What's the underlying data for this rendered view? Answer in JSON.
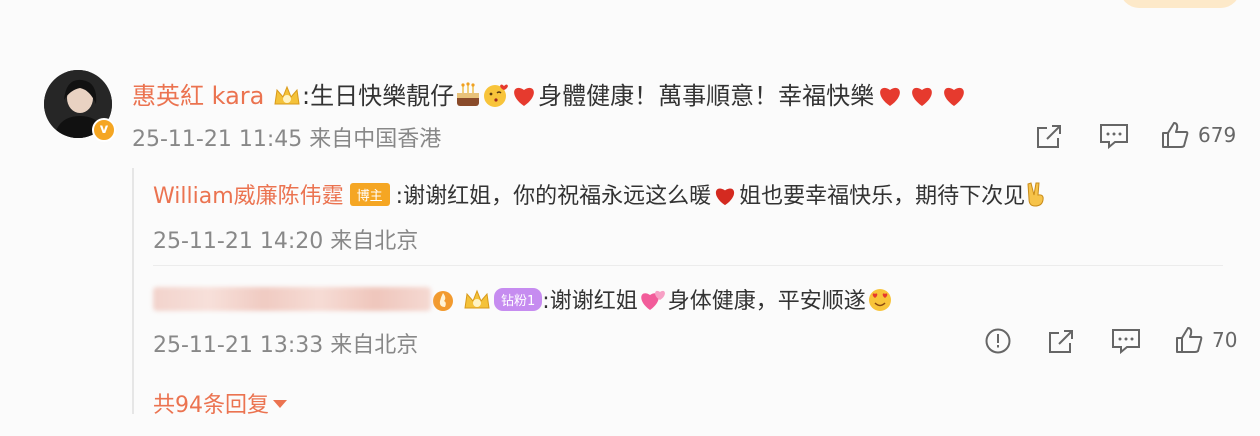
{
  "main_comment": {
    "username": "惠英紅 kara",
    "text_part1": ":生日快樂靚仔",
    "text_part2": "身體健康！萬事順意！幸福快樂",
    "time": "25-11-21 11:45",
    "source": "来自中国香港",
    "like_count": "679",
    "icons": [
      "share-icon",
      "comment-icon",
      "like-icon"
    ],
    "emoji_icons": [
      "cake-icon",
      "kiss-face-icon",
      "heart-icon"
    ]
  },
  "replies": [
    {
      "username": "William威廉陈伟霆",
      "tag": "博主",
      "text_part1": ":谢谢红姐，你的祝福永远这么暖",
      "text_part2": "姐也要幸福快乐，期待下次见",
      "time": "25-11-21 14:20",
      "source": "来自北京",
      "emoji_icons": [
        "heart-icon",
        "victory-hand-icon"
      ]
    },
    {
      "tag": "钻粉1",
      "text_part1": ":谢谢红姐",
      "text_part2": "身体健康，平安顺遂",
      "time": "25-11-21 13:33",
      "source": "来自北京",
      "like_count": "70",
      "icons": [
        "report-icon",
        "share-icon",
        "comment-icon",
        "like-icon"
      ],
      "emoji_icons": [
        "pink-hearts-icon",
        "heart-eyes-icon"
      ]
    }
  ],
  "more_replies": "共94条回复",
  "colors": {
    "username": "#eb7350",
    "meta": "#888888",
    "heart": "#e63a2e",
    "host_tag": "#f5a623",
    "fan_tag": "#c68cf0",
    "background": "#fbfbfb"
  }
}
